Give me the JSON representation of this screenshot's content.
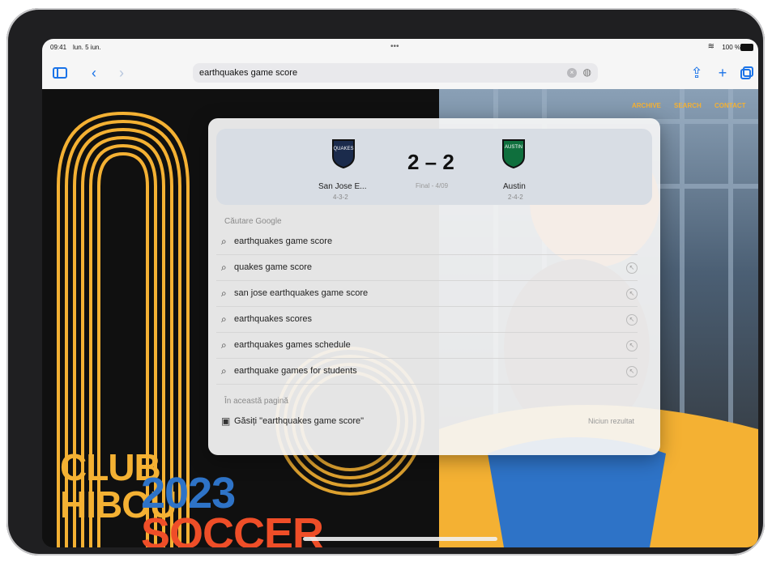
{
  "status_bar": {
    "time": "09:41",
    "date": "lun. 5 iun.",
    "battery": "100 %"
  },
  "browser": {
    "url_text": "earthquakes game score",
    "toolbar_icons": [
      "sidebar-icon",
      "back-icon",
      "forward-icon",
      "share-icon",
      "plus-icon",
      "tabs-icon"
    ]
  },
  "site_nav": [
    "ARCHIVE",
    "SEARCH",
    "CONTACT"
  ],
  "poster": {
    "club": "CLUB",
    "hibou": "HIBOU",
    "year": "2023",
    "sport": "SOCCER"
  },
  "scorecard": {
    "home_team": {
      "name": "San Jose E...",
      "record": "4-3-2"
    },
    "away_team": {
      "name": "Austin",
      "record": "2-4-2"
    },
    "score": "2 – 2",
    "status": "Final - 4/09",
    "home_badge": "QUAKES",
    "away_badge": "AUSTIN"
  },
  "search": {
    "section_google": "Căutare Google",
    "suggestions": [
      "earthquakes game score",
      "quakes game score",
      "san jose earthquakes game score",
      "earthquakes scores",
      "earthquakes games schedule",
      "earthquake games for students"
    ],
    "section_page": "În această pagină",
    "find_label": "Găsiți \"earthquakes game score\"",
    "find_result": "Niciun rezultat"
  },
  "colors": {
    "accent": "#1a73e8",
    "poster_orange": "#f4b133",
    "poster_blue": "#2e73c7",
    "poster_red": "#ef4e28"
  }
}
